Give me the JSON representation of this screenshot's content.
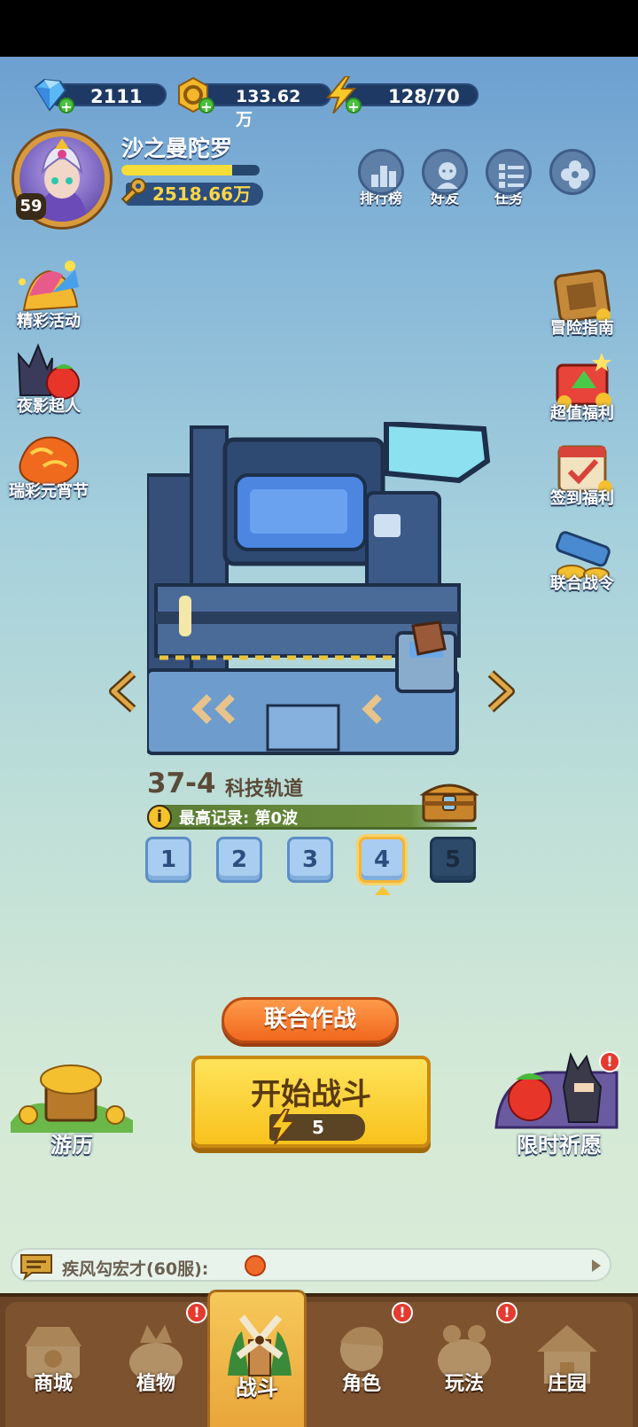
{
  "resources": {
    "diamond": "2111",
    "gold": "133.62万",
    "energy": "128/70"
  },
  "player": {
    "name": "沙之曼陀罗",
    "level": "59",
    "power": "2518.66万",
    "xp_fraction": 0.8
  },
  "top_buttons": {
    "ranking": "排行榜",
    "friends": "好友",
    "tasks": "任务"
  },
  "left_side": {
    "events": "精彩活动",
    "night_hero": "夜影超人",
    "lantern": "瑞彩元宵节"
  },
  "right_side": {
    "guide": "冒险指南",
    "value": "超值福利",
    "checkin": "签到福利",
    "battlepass": "联合战令"
  },
  "stage": {
    "number": "37-4",
    "name": "科技轨道",
    "record": "最高记录: 第0波",
    "levels": [
      "1",
      "2",
      "3",
      "4",
      "5"
    ],
    "selected_index": 3
  },
  "actions": {
    "coop": "联合作战",
    "start": "开始战斗",
    "start_cost": "5",
    "travel": "游历",
    "wish": "限时祈愿"
  },
  "chat": {
    "text": "疾风勾宏才(60服):"
  },
  "nav": {
    "shop": "商城",
    "plants": "植物",
    "battle": "战斗",
    "roles": "角色",
    "modes": "玩法",
    "manor": "庄园"
  },
  "colors": {
    "accent_orange": "#f0681e",
    "start_yellow": "#f8c21c",
    "nav_brown": "#7d532f",
    "alert_red": "#e53a2e"
  }
}
